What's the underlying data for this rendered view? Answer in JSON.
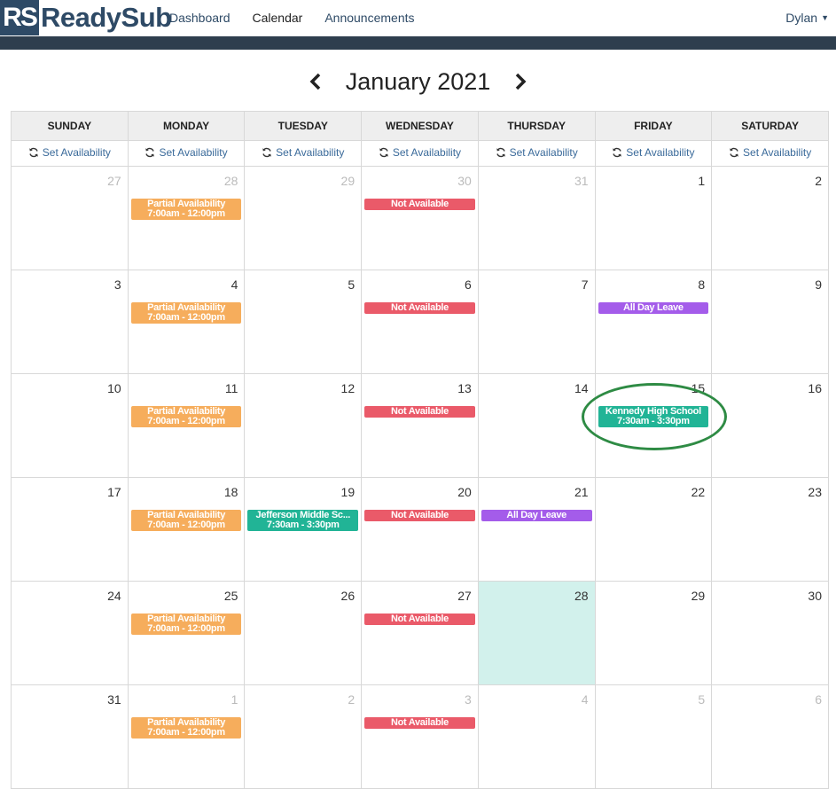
{
  "brand": {
    "mark": "RS",
    "name": "ReadySub"
  },
  "nav": {
    "items": [
      {
        "label": "Dashboard",
        "active": false
      },
      {
        "label": "Calendar",
        "active": true
      },
      {
        "label": "Announcements",
        "active": false
      }
    ],
    "user": "Dylan"
  },
  "month_title": "January 2021",
  "weekdays": [
    "Sunday",
    "Monday",
    "Tuesday",
    "Wednesday",
    "Thursday",
    "Friday",
    "Saturday"
  ],
  "set_availability_label": "Set Availability",
  "event_colors": {
    "orange": "#f6ad5c",
    "red": "#ea5a69",
    "purple": "#a45cea",
    "teal": "#21b496"
  },
  "weeks": [
    [
      {
        "day": "27",
        "muted": true
      },
      {
        "day": "28",
        "muted": true,
        "event": {
          "color": "orange",
          "lines": [
            "Partial Availability",
            "7:00am - 12:00pm"
          ]
        }
      },
      {
        "day": "29",
        "muted": true
      },
      {
        "day": "30",
        "muted": true,
        "event": {
          "color": "red",
          "lines": [
            "Not Available"
          ]
        }
      },
      {
        "day": "31",
        "muted": true
      },
      {
        "day": "1"
      },
      {
        "day": "2"
      }
    ],
    [
      {
        "day": "3"
      },
      {
        "day": "4",
        "event": {
          "color": "orange",
          "lines": [
            "Partial Availability",
            "7:00am - 12:00pm"
          ]
        }
      },
      {
        "day": "5"
      },
      {
        "day": "6",
        "event": {
          "color": "red",
          "lines": [
            "Not Available"
          ]
        }
      },
      {
        "day": "7"
      },
      {
        "day": "8",
        "event": {
          "color": "purple",
          "lines": [
            "All Day Leave"
          ]
        }
      },
      {
        "day": "9"
      }
    ],
    [
      {
        "day": "10"
      },
      {
        "day": "11",
        "event": {
          "color": "orange",
          "lines": [
            "Partial Availability",
            "7:00am - 12:00pm"
          ]
        }
      },
      {
        "day": "12"
      },
      {
        "day": "13",
        "event": {
          "color": "red",
          "lines": [
            "Not Available"
          ]
        }
      },
      {
        "day": "14"
      },
      {
        "day": "15",
        "event": {
          "color": "teal",
          "lines": [
            "Kennedy High School",
            "7:30am - 3:30pm"
          ]
        }
      },
      {
        "day": "16"
      }
    ],
    [
      {
        "day": "17"
      },
      {
        "day": "18",
        "event": {
          "color": "orange",
          "lines": [
            "Partial Availability",
            "7:00am - 12:00pm"
          ]
        }
      },
      {
        "day": "19",
        "event": {
          "color": "teal",
          "lines": [
            "Jefferson Middle Sc...",
            "7:30am - 3:30pm"
          ]
        }
      },
      {
        "day": "20",
        "event": {
          "color": "red",
          "lines": [
            "Not Available"
          ]
        }
      },
      {
        "day": "21",
        "event": {
          "color": "purple",
          "lines": [
            "All Day Leave"
          ]
        }
      },
      {
        "day": "22"
      },
      {
        "day": "23"
      }
    ],
    [
      {
        "day": "24"
      },
      {
        "day": "25",
        "event": {
          "color": "orange",
          "lines": [
            "Partial Availability",
            "7:00am - 12:00pm"
          ]
        }
      },
      {
        "day": "26"
      },
      {
        "day": "27",
        "event": {
          "color": "red",
          "lines": [
            "Not Available"
          ]
        }
      },
      {
        "day": "28",
        "today": true
      },
      {
        "day": "29"
      },
      {
        "day": "30"
      }
    ],
    [
      {
        "day": "31"
      },
      {
        "day": "1",
        "muted": true,
        "event": {
          "color": "orange",
          "lines": [
            "Partial Availability",
            "7:00am - 12:00pm"
          ]
        }
      },
      {
        "day": "2",
        "muted": true
      },
      {
        "day": "3",
        "muted": true,
        "event": {
          "color": "red",
          "lines": [
            "Not Available"
          ]
        }
      },
      {
        "day": "4",
        "muted": true
      },
      {
        "day": "5",
        "muted": true
      },
      {
        "day": "6",
        "muted": true
      }
    ]
  ]
}
